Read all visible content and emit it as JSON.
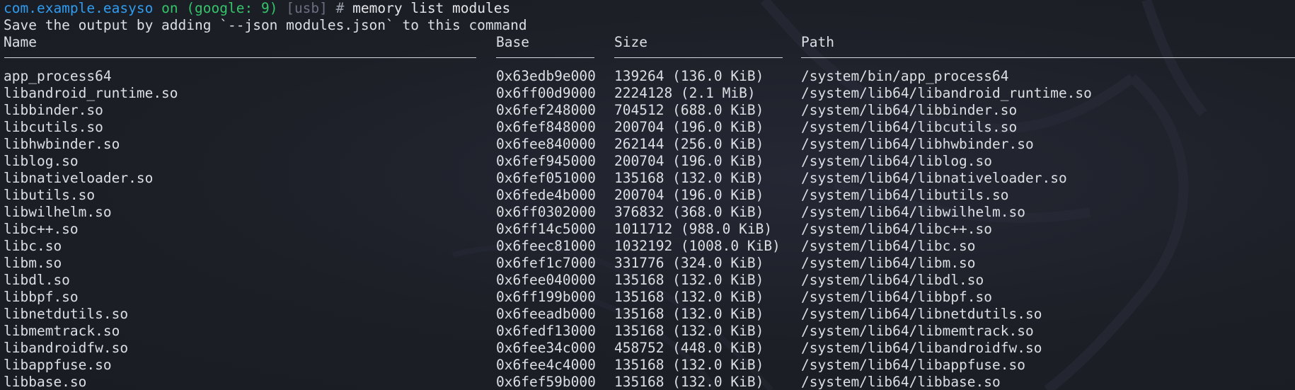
{
  "prompt": {
    "package": "com.example.easyso",
    "on": "on",
    "device": "(google: 9)",
    "transport": "[usb]",
    "hash": "#",
    "command": "memory list modules"
  },
  "hint": "Save the output by adding `--json modules.json` to this command",
  "table": {
    "headers": {
      "name": "Name",
      "base": "Base",
      "size": "Size",
      "path": "Path"
    },
    "rows": [
      {
        "name": "app_process64",
        "base": "0x63edb9e000",
        "size": "139264 (136.0 KiB)",
        "path": "/system/bin/app_process64"
      },
      {
        "name": "libandroid_runtime.so",
        "base": "0x6ff00d9000",
        "size": "2224128 (2.1 MiB)",
        "path": "/system/lib64/libandroid_runtime.so"
      },
      {
        "name": "libbinder.so",
        "base": "0x6fef248000",
        "size": "704512 (688.0 KiB)",
        "path": "/system/lib64/libbinder.so"
      },
      {
        "name": "libcutils.so",
        "base": "0x6fef848000",
        "size": "200704 (196.0 KiB)",
        "path": "/system/lib64/libcutils.so"
      },
      {
        "name": "libhwbinder.so",
        "base": "0x6fee840000",
        "size": "262144 (256.0 KiB)",
        "path": "/system/lib64/libhwbinder.so"
      },
      {
        "name": "liblog.so",
        "base": "0x6fef945000",
        "size": "200704 (196.0 KiB)",
        "path": "/system/lib64/liblog.so"
      },
      {
        "name": "libnativeloader.so",
        "base": "0x6fef051000",
        "size": "135168 (132.0 KiB)",
        "path": "/system/lib64/libnativeloader.so"
      },
      {
        "name": "libutils.so",
        "base": "0x6fede4b000",
        "size": "200704 (196.0 KiB)",
        "path": "/system/lib64/libutils.so"
      },
      {
        "name": "libwilhelm.so",
        "base": "0x6ff0302000",
        "size": "376832 (368.0 KiB)",
        "path": "/system/lib64/libwilhelm.so"
      },
      {
        "name": "libc++.so",
        "base": "0x6ff14c5000",
        "size": "1011712 (988.0 KiB)",
        "path": "/system/lib64/libc++.so"
      },
      {
        "name": "libc.so",
        "base": "0x6feec81000",
        "size": "1032192 (1008.0 KiB)",
        "path": "/system/lib64/libc.so"
      },
      {
        "name": "libm.so",
        "base": "0x6fef1c7000",
        "size": "331776 (324.0 KiB)",
        "path": "/system/lib64/libm.so"
      },
      {
        "name": "libdl.so",
        "base": "0x6fee040000",
        "size": "135168 (132.0 KiB)",
        "path": "/system/lib64/libdl.so"
      },
      {
        "name": "libbpf.so",
        "base": "0x6ff199b000",
        "size": "135168 (132.0 KiB)",
        "path": "/system/lib64/libbpf.so"
      },
      {
        "name": "libnetdutils.so",
        "base": "0x6feeadb000",
        "size": "135168 (132.0 KiB)",
        "path": "/system/lib64/libnetdutils.so"
      },
      {
        "name": "libmemtrack.so",
        "base": "0x6fedf13000",
        "size": "135168 (132.0 KiB)",
        "path": "/system/lib64/libmemtrack.so"
      },
      {
        "name": "libandroidfw.so",
        "base": "0x6fee34c000",
        "size": "458752 (448.0 KiB)",
        "path": "/system/lib64/libandroidfw.so"
      },
      {
        "name": "libappfuse.so",
        "base": "0x6fee4c4000",
        "size": "135168 (132.0 KiB)",
        "path": "/system/lib64/libappfuse.so"
      },
      {
        "name": "libbase.so",
        "base": "0x6fef59b000",
        "size": "135168 (132.0 KiB)",
        "path": "/system/lib64/libbase.so"
      }
    ]
  },
  "colors": {
    "background": "#1c1e26",
    "foreground": "#dcdfe4",
    "prompt_package": "#2f9cf0",
    "prompt_green": "#35c46a",
    "prompt_dim": "#6b7080"
  }
}
